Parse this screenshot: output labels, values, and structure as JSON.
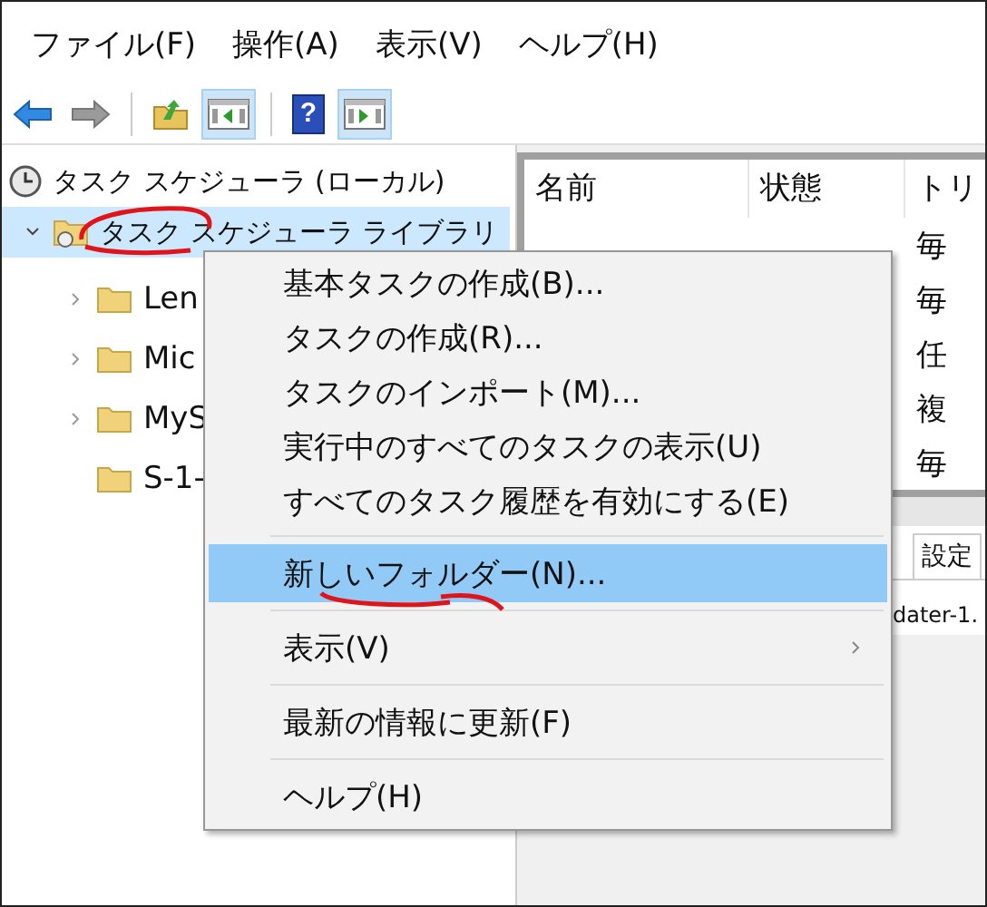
{
  "menu_bar": [
    "ファイル(F)",
    "操作(A)",
    "表示(V)",
    "ヘルプ(H)"
  ],
  "toolbar": [
    {
      "kind": "back",
      "disabled": false,
      "selected": false
    },
    {
      "kind": "forward",
      "disabled": true,
      "selected": false
    },
    {
      "kind": "separator"
    },
    {
      "kind": "up",
      "disabled": false,
      "selected": false
    },
    {
      "kind": "pane-left",
      "disabled": false,
      "selected": true
    },
    {
      "kind": "separator"
    },
    {
      "kind": "help",
      "glyph": "?",
      "disabled": false,
      "selected": false
    },
    {
      "kind": "pane-right",
      "disabled": false,
      "selected": true
    }
  ],
  "tree": {
    "label": "タスク スケジューラ (ローカル)",
    "children": [
      {
        "label": "タスク スケジューラ ライブラリ",
        "selected": true,
        "expanded": true,
        "children": [
          {
            "label": "Len",
            "expandable": true
          },
          {
            "label": "Mic",
            "expandable": true
          },
          {
            "label": "MyS",
            "expandable": true
          },
          {
            "label": "S-1-",
            "expandable": false
          }
        ]
      }
    ]
  },
  "table": {
    "columns": [
      "名前",
      "状態",
      "トリ"
    ],
    "rows": [
      {
        "column_3": "毎"
      },
      {
        "column_3": "毎"
      },
      {
        "column_3": "任"
      },
      {
        "column_3": "複"
      },
      {
        "column_3": "毎"
      }
    ]
  },
  "detail": {
    "tabs": [
      "設定"
    ],
    "text": "dater-1."
  },
  "context_menu": [
    {
      "kind": "item",
      "label": "基本タスクの作成(B)...",
      "selected": false,
      "submenu": false
    },
    {
      "kind": "item",
      "label": "タスクの作成(R)...",
      "selected": false,
      "submenu": false
    },
    {
      "kind": "item",
      "label": "タスクのインポート(M)...",
      "selected": false,
      "submenu": false
    },
    {
      "kind": "item",
      "label": "実行中のすべてのタスクの表示(U)",
      "selected": false,
      "submenu": false
    },
    {
      "kind": "item",
      "label": "すべてのタスク履歴を有効にする(E)",
      "selected": false,
      "submenu": false
    },
    {
      "kind": "separator"
    },
    {
      "kind": "item",
      "label": "新しいフォルダー(N)...",
      "selected": true,
      "submenu": false
    },
    {
      "kind": "separator"
    },
    {
      "kind": "item",
      "label": "表示(V)",
      "selected": false,
      "submenu": true
    },
    {
      "kind": "separator"
    },
    {
      "kind": "item",
      "label": "最新の情報に更新(F)",
      "selected": false,
      "submenu": false
    },
    {
      "kind": "separator"
    },
    {
      "kind": "item",
      "label": "ヘルプ(H)",
      "selected": false,
      "submenu": false
    }
  ]
}
